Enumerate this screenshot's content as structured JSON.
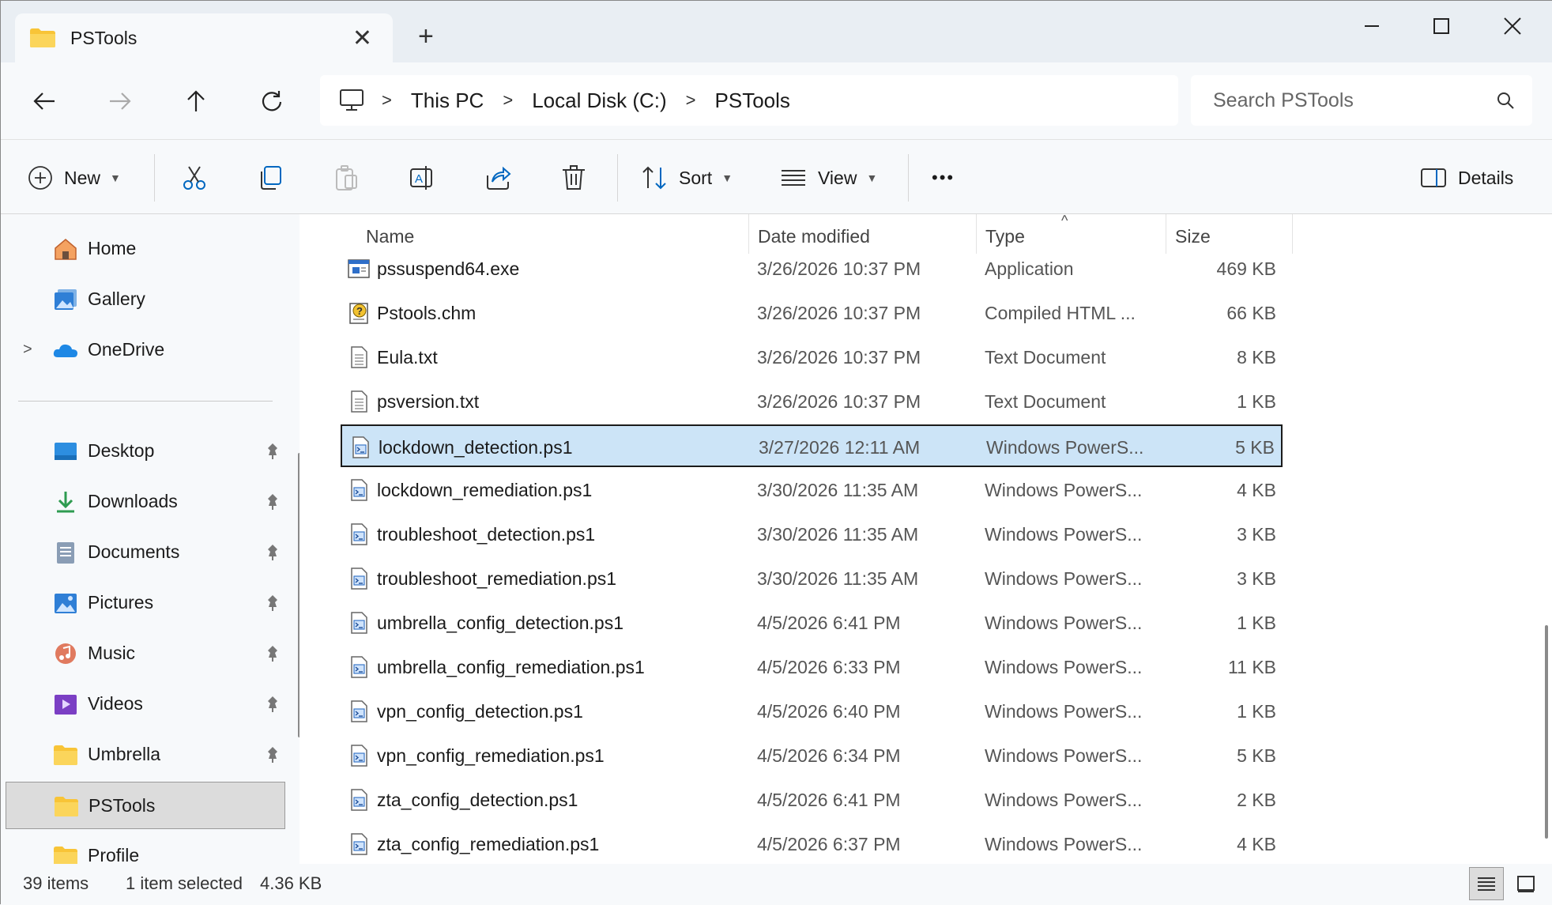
{
  "window": {
    "tab_label": "PSTools",
    "colors": {
      "accent": "#0067c0",
      "selection": "#cce4f7",
      "folder": "#f8c437"
    }
  },
  "address": {
    "breadcrumbs": [
      "This PC",
      "Local Disk (C:)",
      "PSTools"
    ],
    "search_placeholder": "Search PSTools"
  },
  "command_bar": {
    "new_label": "New",
    "sort_label": "Sort",
    "view_label": "View",
    "more_label": "•••",
    "details_label": "Details",
    "icons": [
      "cut-icon",
      "copy-icon",
      "paste-icon",
      "rename-icon",
      "share-icon",
      "delete-icon"
    ]
  },
  "sidebar": {
    "top_items": [
      {
        "label": "Home",
        "icon": "home-icon"
      },
      {
        "label": "Gallery",
        "icon": "gallery-icon"
      },
      {
        "label": "OneDrive",
        "icon": "onedrive-icon"
      }
    ],
    "pinned_items": [
      {
        "label": "Desktop",
        "icon": "desktop-icon"
      },
      {
        "label": "Downloads",
        "icon": "downloads-icon"
      },
      {
        "label": "Documents",
        "icon": "documents-icon"
      },
      {
        "label": "Pictures",
        "icon": "pictures-icon"
      },
      {
        "label": "Music",
        "icon": "music-icon"
      },
      {
        "label": "Videos",
        "icon": "videos-icon"
      },
      {
        "label": "Umbrella",
        "icon": "folder-icon"
      },
      {
        "label": "PSTools",
        "icon": "folder-icon"
      },
      {
        "label": "Profile",
        "icon": "folder-icon"
      }
    ]
  },
  "columns": {
    "name": "Name",
    "date": "Date modified",
    "type": "Type",
    "size": "Size"
  },
  "files": [
    {
      "name": "pssuspend64.exe",
      "date": "3/26/2026 10:37 PM",
      "type": "Application",
      "size": "469 KB",
      "icon": "exe"
    },
    {
      "name": "Pstools.chm",
      "date": "3/26/2026 10:37 PM",
      "type": "Compiled HTML ...",
      "size": "66 KB",
      "icon": "chm"
    },
    {
      "name": "Eula.txt",
      "date": "3/26/2026 10:37 PM",
      "type": "Text Document",
      "size": "8 KB",
      "icon": "txt"
    },
    {
      "name": "psversion.txt",
      "date": "3/26/2026 10:37 PM",
      "type": "Text Document",
      "size": "1 KB",
      "icon": "txt"
    },
    {
      "name": "lockdown_detection.ps1",
      "date": "3/27/2026 12:11 AM",
      "type": "Windows PowerS...",
      "size": "5 KB",
      "icon": "ps1",
      "selected": true
    },
    {
      "name": "lockdown_remediation.ps1",
      "date": "3/30/2026 11:35 AM",
      "type": "Windows PowerS...",
      "size": "4 KB",
      "icon": "ps1"
    },
    {
      "name": "troubleshoot_detection.ps1",
      "date": "3/30/2026 11:35 AM",
      "type": "Windows PowerS...",
      "size": "3 KB",
      "icon": "ps1"
    },
    {
      "name": "troubleshoot_remediation.ps1",
      "date": "3/30/2026 11:35 AM",
      "type": "Windows PowerS...",
      "size": "3 KB",
      "icon": "ps1"
    },
    {
      "name": "umbrella_config_detection.ps1",
      "date": "4/5/2026 6:41 PM",
      "type": "Windows PowerS...",
      "size": "1 KB",
      "icon": "ps1"
    },
    {
      "name": "umbrella_config_remediation.ps1",
      "date": "4/5/2026 6:33 PM",
      "type": "Windows PowerS...",
      "size": "11 KB",
      "icon": "ps1"
    },
    {
      "name": "vpn_config_detection.ps1",
      "date": "4/5/2026 6:40 PM",
      "type": "Windows PowerS...",
      "size": "1 KB",
      "icon": "ps1"
    },
    {
      "name": "vpn_config_remediation.ps1",
      "date": "4/5/2026 6:34 PM",
      "type": "Windows PowerS...",
      "size": "5 KB",
      "icon": "ps1"
    },
    {
      "name": "zta_config_detection.ps1",
      "date": "4/5/2026 6:41 PM",
      "type": "Windows PowerS...",
      "size": "2 KB",
      "icon": "ps1"
    },
    {
      "name": "zta_config_remediation.ps1",
      "date": "4/5/2026 6:37 PM",
      "type": "Windows PowerS...",
      "size": "4 KB",
      "icon": "ps1"
    }
  ],
  "status": {
    "item_count": "39 items",
    "selection": "1 item selected",
    "selection_size": "4.36 KB"
  }
}
